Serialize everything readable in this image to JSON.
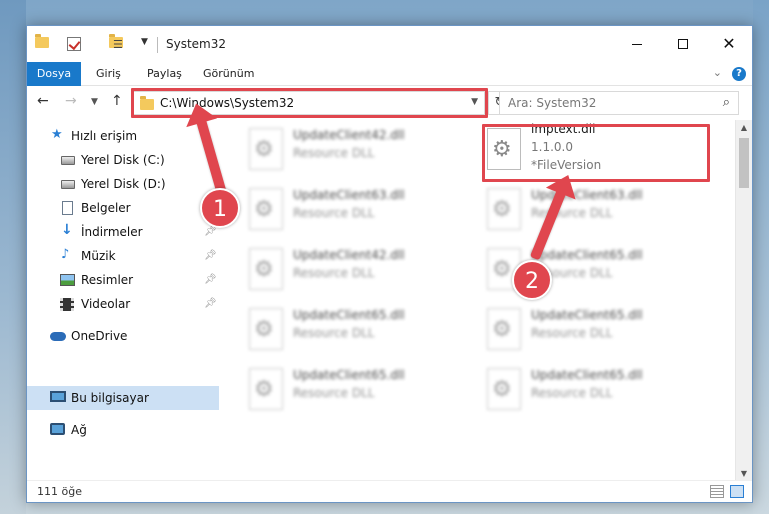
{
  "window": {
    "title": "System32"
  },
  "ribbon": {
    "tabs": [
      "Dosya",
      "Giriş",
      "Paylaş",
      "Görünüm"
    ],
    "help": "?"
  },
  "address": {
    "path": "C:\\Windows\\System32"
  },
  "search": {
    "placeholder": "Ara: System32"
  },
  "sidebar": {
    "items": [
      {
        "label": "Hızlı erişim",
        "icon": "star-icon"
      },
      {
        "label": "Yerel Disk (C:)",
        "icon": "drive-icon"
      },
      {
        "label": "Yerel Disk (D:)",
        "icon": "drive-icon"
      },
      {
        "label": "Belgeler",
        "icon": "documents-icon"
      },
      {
        "label": "İndirmeler",
        "icon": "download-icon"
      },
      {
        "label": "Müzik",
        "icon": "music-icon"
      },
      {
        "label": "Resimler",
        "icon": "pictures-icon"
      },
      {
        "label": "Videolar",
        "icon": "videos-icon"
      },
      {
        "label": "OneDrive",
        "icon": "cloud-icon"
      },
      {
        "label": "Bu bilgisayar",
        "icon": "computer-icon"
      },
      {
        "label": "Ağ",
        "icon": "network-icon"
      }
    ]
  },
  "files": {
    "left": [
      {
        "name": "UpdateClient42.dll",
        "type": "Resource DLL"
      },
      {
        "name": "UpdateClient63.dll",
        "type": "Resource DLL"
      },
      {
        "name": "UpdateClient42.dll",
        "type": "Resource DLL"
      },
      {
        "name": "UpdateClient65.dll",
        "type": "Resource DLL"
      },
      {
        "name": "UpdateClient65.dll",
        "type": "Resource DLL"
      }
    ],
    "right": [
      {
        "name": "UpdateClient63.dll",
        "type": "Resource DLL"
      },
      {
        "name": "UpdateClient65.dll",
        "type": "Resource DLL"
      },
      {
        "name": "UpdateClient65.dll",
        "type": "Resource DLL"
      },
      {
        "name": "UpdateClient65.dll",
        "type": "Resource DLL"
      }
    ],
    "highlighted": {
      "name": "imptext.dll",
      "version": "1.1.0.0",
      "type": "*FileVersion"
    }
  },
  "status": {
    "count": "111 öğe"
  },
  "annotations": {
    "step1": "1",
    "step2": "2",
    "color": "#e0464e"
  }
}
